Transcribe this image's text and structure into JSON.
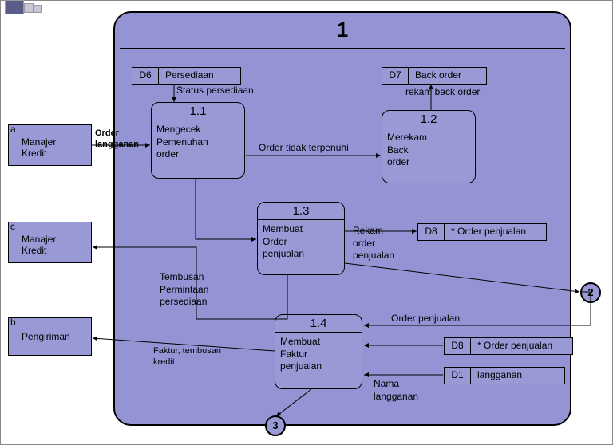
{
  "main": {
    "id": "1"
  },
  "externals": {
    "a": {
      "letter": "a",
      "name": "Manajer\nKredit"
    },
    "c": {
      "letter": "c",
      "name": "Manajer\nKredit"
    },
    "b": {
      "letter": "b",
      "name": "Pengiriman"
    }
  },
  "datastores": {
    "d6": {
      "id": "D6",
      "name": "Persediaan"
    },
    "d7": {
      "id": "D7",
      "name": "Back order"
    },
    "d8a": {
      "id": "D8",
      "name": "* Order penjualan"
    },
    "d8b": {
      "id": "D8",
      "name": "* Order penjualan"
    },
    "d1": {
      "id": "D1",
      "name": "langganan"
    }
  },
  "processes": {
    "p11": {
      "id": "1.1",
      "name": "Mengecek\nPemenuhan\norder"
    },
    "p12": {
      "id": "1.2",
      "name": "Merekam\nBack\norder"
    },
    "p13": {
      "id": "1.3",
      "name": "Membuat\nOrder\npenjualan"
    },
    "p14": {
      "id": "1.4",
      "name": "Membuat\nFaktur\npenjualan"
    }
  },
  "flows": {
    "order_langganan": "Order\nlangganan",
    "status_persediaan": "Status persediaan",
    "order_tidak": "Order tidak terpenuhi",
    "rekam_back_order": "rekam back order",
    "rekam_order_penj": "Rekam\norder\npenjualan",
    "tembusan": "Tembusan\nPermintaan\npersediaan",
    "faktur": "Faktur, tembusan\nkredit",
    "order_penjualan": "Order penjualan",
    "nama_langganan": "Nama\nlangganan"
  },
  "connectors": {
    "c2": "2",
    "c3": "3"
  }
}
